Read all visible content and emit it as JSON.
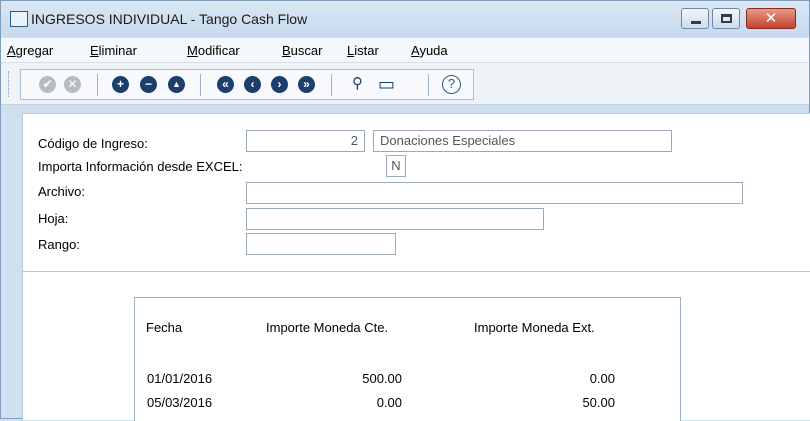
{
  "window": {
    "title": "INGRESOS INDIVIDUAL - Tango Cash Flow",
    "close_glyph": "✕"
  },
  "menu": [
    {
      "label": "Agregar"
    },
    {
      "label": "Eliminar"
    },
    {
      "label": "Modificar"
    },
    {
      "label": "Buscar"
    },
    {
      "label": "Listar"
    },
    {
      "label": "Ayuda"
    }
  ],
  "toolbar": {
    "accept": "✔",
    "cancel": "✕",
    "add": "+",
    "remove": "−",
    "up": "▲",
    "first": "«",
    "prev": "‹",
    "next": "›",
    "last": "»",
    "find": "⚲",
    "display": "▭",
    "help": "?"
  },
  "form": {
    "codigo_label": "Código de Ingreso:",
    "codigo_value": "2",
    "descripcion_value": "Donaciones Especiales",
    "importa_label": "Importa Información desde EXCEL:",
    "importa_value": "N",
    "archivo_label": "Archivo:",
    "archivo_value": "",
    "hoja_label": "Hoja:",
    "hoja_value": "",
    "rango_label": "Rango:",
    "rango_value": ""
  },
  "grid": {
    "headers": [
      "Fecha",
      "Importe Moneda Cte.",
      "Importe Moneda Ext."
    ],
    "rows": [
      [
        "01/01/2016",
        "500.00",
        "0.00"
      ],
      [
        "05/03/2016",
        "0.00",
        "50.00"
      ]
    ]
  },
  "colors": {
    "toolbar_icon_active": "#1c3f70",
    "toolbar_icon_disabled": "#b7bcc3",
    "close_button": "#c7422e"
  }
}
